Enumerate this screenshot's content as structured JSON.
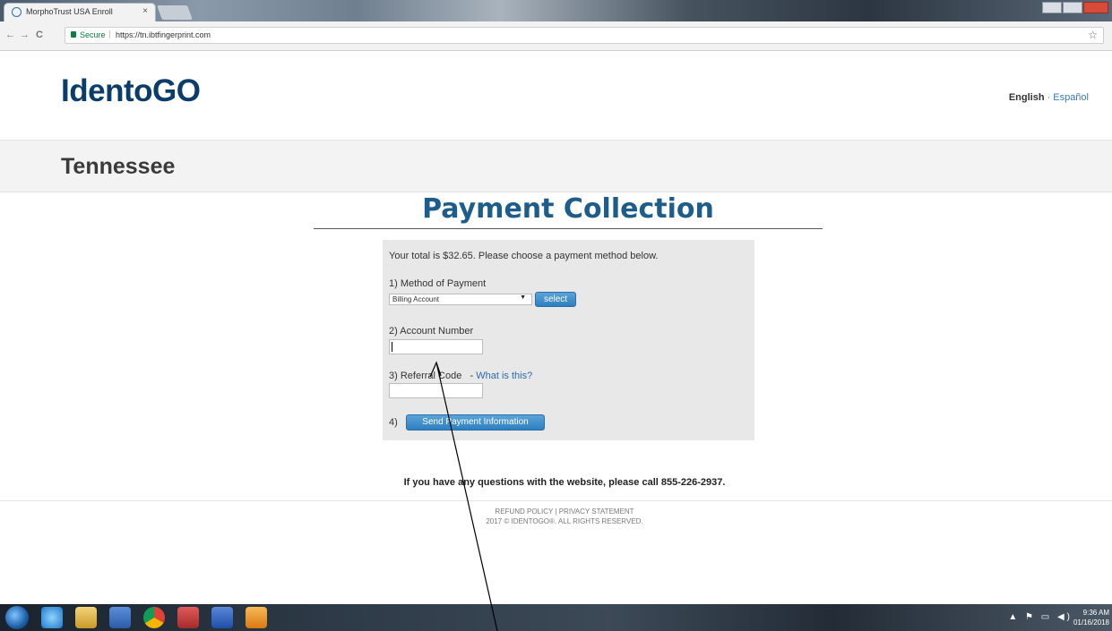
{
  "browser": {
    "tab_title": "MorphoTrust USA Enroll",
    "tab_close": "×",
    "back": "←",
    "forward": "→",
    "reload": "C",
    "secure_label": "Secure",
    "separator": "|",
    "url": "https://tn.ibtfingerprint.com",
    "bookmark": "☆"
  },
  "header": {
    "logo": "IdentoGO",
    "lang_english": "English",
    "lang_dot": "·",
    "lang_spanish": "Español"
  },
  "state": "Tennessee",
  "payment": {
    "title": "Payment Collection",
    "total_text": "Your total is $32.65. Please choose a payment method below.",
    "step1_label": "1) Method of Payment",
    "method_selected": "Billing Account",
    "select_arrow": "▼",
    "select_button": "select",
    "step2_label": "2) Account Number",
    "account_value": "",
    "step3_label": "3) Referral Code",
    "step3_dash": "-",
    "what_link": "What is this?",
    "referral_value": "",
    "step4_label": "4)",
    "send_button": "Send Payment Information"
  },
  "help_line": "If you have any questions with the website, please call 855-226-2937.",
  "footer": {
    "links": "REFUND POLICY | PRIVACY STATEMENT",
    "copyright": "2017 © IDENTOGO®. ALL RIGHTS RESERVED."
  },
  "taskbar": {
    "tray": "▲ ⚑ ▭ ◀)",
    "time": "9:36 AM",
    "date": "01/16/2018"
  },
  "colors": {
    "logo": "#0a3d6b",
    "title": "#1d5d8c",
    "button": "#2e7fc0",
    "link": "#2b6cb0"
  }
}
